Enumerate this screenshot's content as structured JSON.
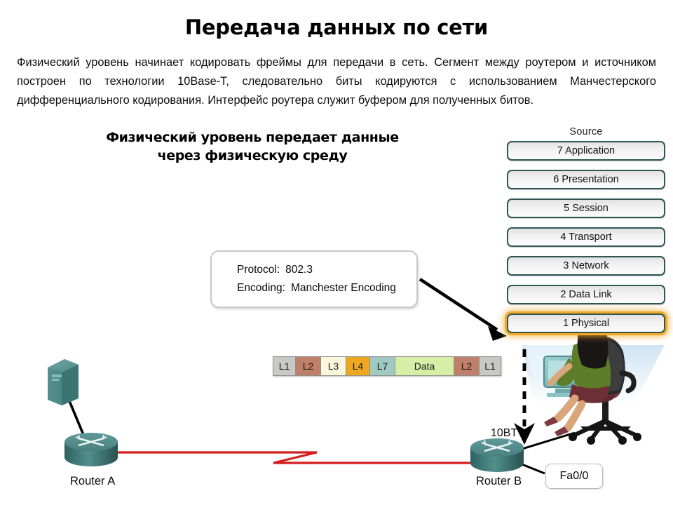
{
  "slide": {
    "title": "Передача данных по сети",
    "body": "Физический уровень начинает кодировать фреймы для передачи в сеть. Сегмент между роутером и источником построен по технологии 10Base-T, следовательно биты кодируются с использованием Манчестерского дифференциального кодирования. Интерфейс роутера служит буфером для полученных битов."
  },
  "diagram": {
    "caption_line1": "Физический уровень передает данные",
    "caption_line2": "через физическую среду",
    "osi": {
      "title": "Source",
      "layers": [
        {
          "label": "7 Application",
          "highlight": false
        },
        {
          "label": "6 Presentation",
          "highlight": false
        },
        {
          "label": "5 Session",
          "highlight": false
        },
        {
          "label": "4 Transport",
          "highlight": false
        },
        {
          "label": "3 Network",
          "highlight": false
        },
        {
          "label": "2 Data Link",
          "highlight": false
        },
        {
          "label": "1 Physical",
          "highlight": true
        }
      ],
      "highlight_color": "#f0a92a",
      "border_color": "#2e5750"
    },
    "protocol_callout": {
      "row1_key": "Protocol:",
      "row1_value": "802.3",
      "row2_key": "Encoding:",
      "row2_value": "Manchester Encoding"
    },
    "interface_callout": {
      "label": "Fa0/0"
    },
    "pdu_bar": {
      "segments": [
        {
          "label": "L1",
          "color": "#c8c8c4",
          "width": 32
        },
        {
          "label": "L2",
          "color": "#c07f68",
          "width": 36
        },
        {
          "label": "L3",
          "color": "#fbf7dc",
          "width": 36
        },
        {
          "label": "L4",
          "color": "#eda81f",
          "width": 34
        },
        {
          "label": "L7",
          "color": "#9fc9c1",
          "width": 36
        },
        {
          "label": "Data",
          "color": "#d7eea7",
          "width": 84
        },
        {
          "label": "L2",
          "color": "#c07f68",
          "width": 36
        },
        {
          "label": "L1",
          "color": "#c8c8c4",
          "width": 30
        }
      ]
    },
    "devices": {
      "router_a": "Router A",
      "router_b": "Router B",
      "link_label": "10BT"
    },
    "colors": {
      "serial_link": "#d41d1d",
      "device_teal": "#4e8e8c",
      "arrow_black": "#000000"
    }
  }
}
